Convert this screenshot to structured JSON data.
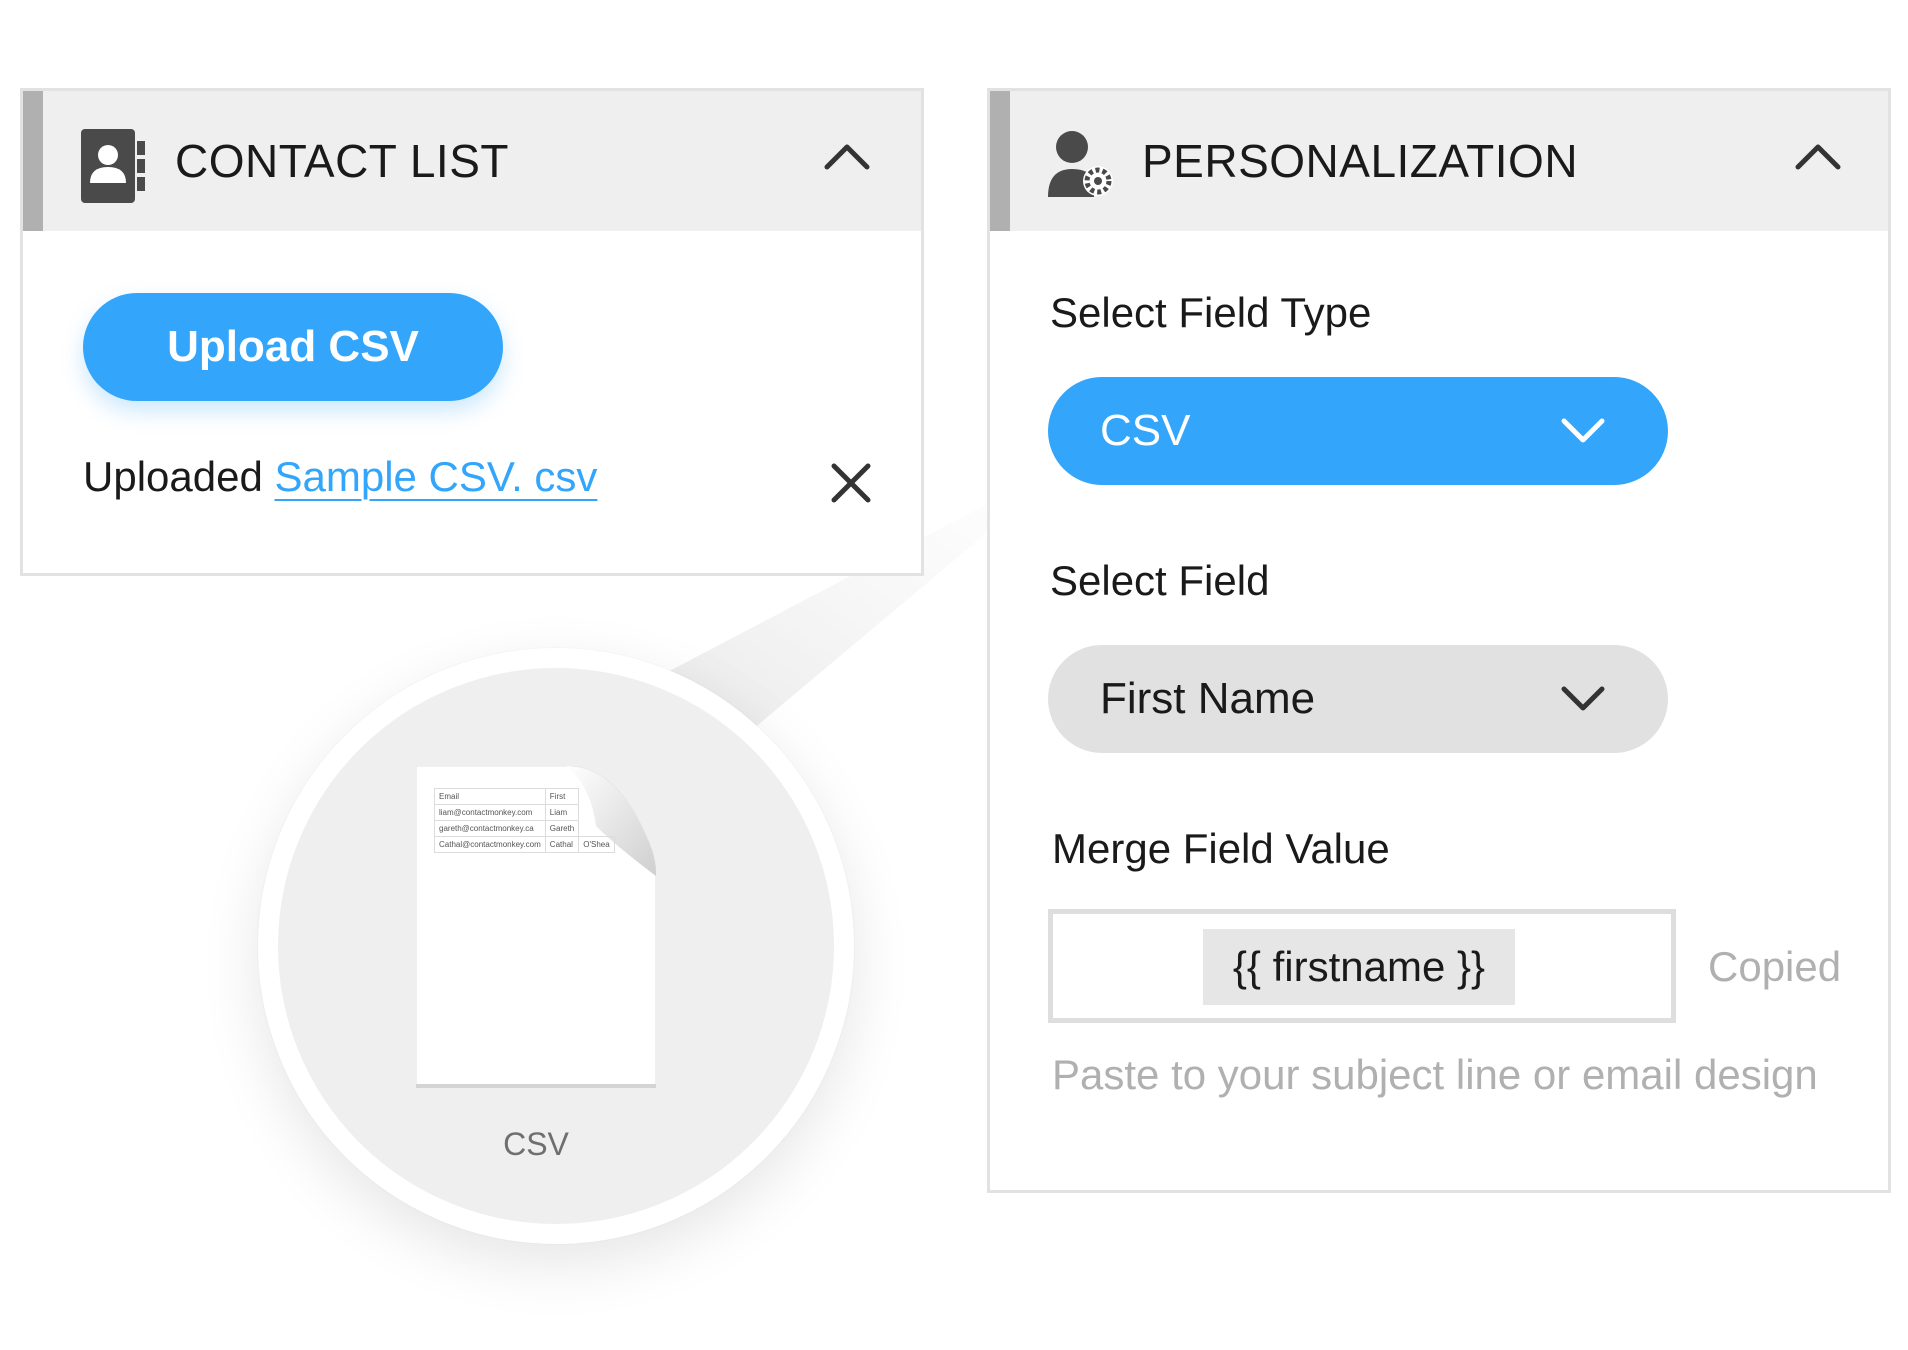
{
  "contact_list": {
    "title": "CONTACT LIST",
    "upload_button": "Upload CSV",
    "uploaded_prefix": "Uploaded",
    "uploaded_file": "Sample CSV. csv",
    "icons": {
      "header": "contact-book-icon",
      "collapse": "chevron-up-icon",
      "remove": "close-icon"
    }
  },
  "personalization": {
    "title": "PERSONALIZATION",
    "field_type_label": "Select Field Type",
    "field_type_value": "CSV",
    "field_label": "Select Field",
    "field_value": "First Name",
    "merge_label": "Merge Field Value",
    "merge_token": "{{ firstname }}",
    "copied_status": "Copied",
    "hint": "Paste to your subject line or email design",
    "icons": {
      "header": "user-settings-icon",
      "collapse": "chevron-up-icon",
      "dropdown": "chevron-down-icon"
    }
  },
  "csv_preview": {
    "label": "CSV",
    "table": [
      [
        "Email",
        "First",
        ""
      ],
      [
        "liam@contactmonkey.com",
        "Liam",
        ""
      ],
      [
        "gareth@contactmonkey.ca",
        "Gareth",
        ""
      ],
      [
        "Cathal@contactmonkey.com",
        "Cathal",
        "O'Shea"
      ]
    ]
  },
  "colors": {
    "accent": "#33a5fa",
    "header_bg": "#efefef",
    "header_stripe": "#b0b0b0",
    "select_grey": "#e1e1e1",
    "muted_text": "#b0b0b0"
  }
}
